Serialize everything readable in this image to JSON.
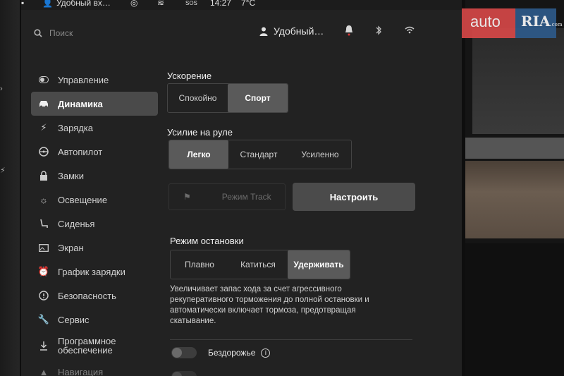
{
  "statusbar": {
    "user": "Удобный вх…",
    "sos": "SOS",
    "time": "14:27",
    "temp": "7°C"
  },
  "top": {
    "search_placeholder": "Поиск",
    "user_name": "Удобный…"
  },
  "sidebar": {
    "items": [
      {
        "label": "Управление",
        "icon": "toggle-icon"
      },
      {
        "label": "Динамика",
        "icon": "car-icon",
        "active": true
      },
      {
        "label": "Зарядка",
        "icon": "lightning-icon"
      },
      {
        "label": "Автопилот",
        "icon": "steering-wheel-icon"
      },
      {
        "label": "Замки",
        "icon": "lock-icon"
      },
      {
        "label": "Освещение",
        "icon": "sun-icon"
      },
      {
        "label": "Сиденья",
        "icon": "seat-icon"
      },
      {
        "label": "Экран",
        "icon": "display-icon"
      },
      {
        "label": "График зарядки",
        "icon": "alarm-clock-icon"
      },
      {
        "label": "Безопасность",
        "icon": "info-circle-icon"
      },
      {
        "label": "Сервис",
        "icon": "wrench-icon"
      },
      {
        "label": "Программное обеспечение",
        "icon": "download-icon"
      },
      {
        "label": "Навигация",
        "icon": "navigation-icon"
      }
    ]
  },
  "acceleration": {
    "title": "Ускорение",
    "options": [
      "Спокойно",
      "Спорт"
    ],
    "selected": 1
  },
  "steering": {
    "title": "Усилие на руле",
    "options": [
      "Легко",
      "Стандарт",
      "Усиленно"
    ],
    "selected": 0
  },
  "track": {
    "label": "Режим Track",
    "configure_label": "Настроить"
  },
  "stopping": {
    "title": "Режим остановки",
    "options": [
      "Плавно",
      "Катиться",
      "Удерживать"
    ],
    "selected": 2,
    "description": "Увеличивает запас хода за счет агрессивного рекуперативного торможения до полной остановки и автоматически включает тормоза, предотвращая скатывание."
  },
  "offroad": {
    "label": "Бездорожье",
    "enabled": false
  },
  "watermark": {
    "part1": "auto",
    "part2": "RIA",
    "domain": ".com"
  },
  "colors": {
    "accent_red": "#d94848",
    "accent_blue": "#2e5b8c",
    "screen_bg": "#222222",
    "selected_bg": "#5a5a5a"
  }
}
